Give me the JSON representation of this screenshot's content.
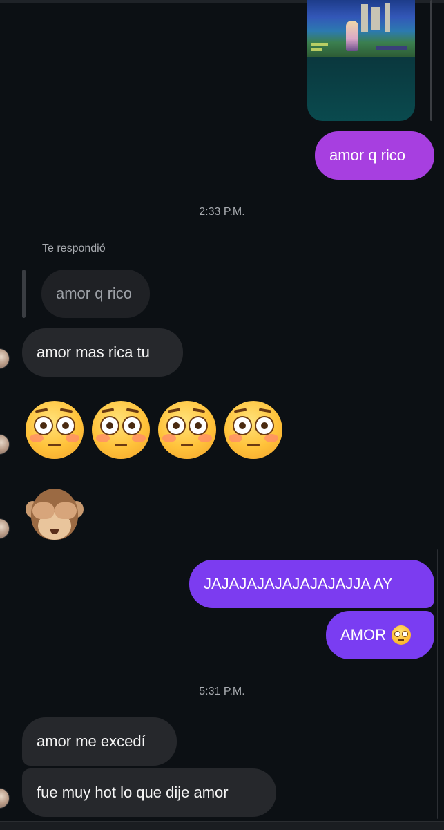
{
  "thread": {
    "shared_media": {
      "kind": "game-screenshot"
    },
    "messages": [
      {
        "id": "m1",
        "direction": "outgoing",
        "text": "amor q rico",
        "color": "#a73fe0"
      },
      {
        "id": "ts1",
        "type": "timestamp",
        "text": "2:33 P.M."
      },
      {
        "id": "m2",
        "direction": "incoming",
        "reply_label": "Te respondió",
        "quoted_text": "amor q rico",
        "text": "amor mas rica tu"
      },
      {
        "id": "m3",
        "direction": "incoming",
        "type": "emoji",
        "emojis": [
          "😳",
          "😳",
          "😳",
          "😳"
        ]
      },
      {
        "id": "m4",
        "direction": "incoming",
        "type": "emoji",
        "emojis": [
          "🙈"
        ]
      },
      {
        "id": "m5",
        "direction": "outgoing",
        "text": "JAJAJAJAJAJAJAJAJJA AY",
        "color": "#7c3cf0"
      },
      {
        "id": "m6",
        "direction": "outgoing",
        "text": "AMOR",
        "emoji": "😳",
        "color": "#7a3df2"
      },
      {
        "id": "ts2",
        "type": "timestamp",
        "text": "5:31 P.M."
      },
      {
        "id": "m7",
        "direction": "incoming",
        "text": "amor me excedí"
      },
      {
        "id": "m8",
        "direction": "incoming",
        "text": "fue muy hot lo que dije amor"
      }
    ]
  },
  "icons": {
    "avatar": "user-avatar",
    "flushed": "flushed-face-emoji",
    "monkey": "see-no-evil-monkey-emoji"
  }
}
